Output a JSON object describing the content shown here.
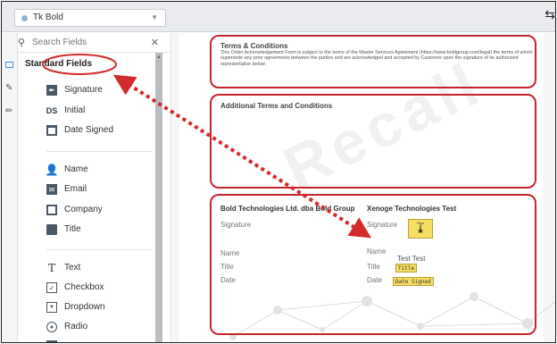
{
  "topbar": {
    "recipient": "Tk Bold",
    "recipient_color": "#8fb7d9"
  },
  "search": {
    "placeholder": "Search Fields"
  },
  "panel": {
    "section_title": "Standard Fields",
    "fields": [
      {
        "label": "Signature",
        "icon": "pen-icon"
      },
      {
        "label": "Initial",
        "icon": "ds-initial-icon",
        "icon_text": "DS"
      },
      {
        "label": "Date Signed",
        "icon": "calendar-icon"
      },
      {
        "label": "Name",
        "icon": "person-icon"
      },
      {
        "label": "Email",
        "icon": "envelope-icon"
      },
      {
        "label": "Company",
        "icon": "building-icon"
      },
      {
        "label": "Title",
        "icon": "briefcase-icon"
      },
      {
        "label": "Text",
        "icon": "text-t-icon",
        "icon_text": "T"
      },
      {
        "label": "Checkbox",
        "icon": "checkbox-icon"
      },
      {
        "label": "Dropdown",
        "icon": "dropdown-icon"
      },
      {
        "label": "Radio",
        "icon": "radio-icon"
      }
    ]
  },
  "document": {
    "terms_title": "Terms & Conditions",
    "terms_body": "This Order Acknowledgement Form is subject to the terms of the Master Services Agreement (https://www.boldgroup.com/legal) the terms of which supersede any prior agreements between the parties and are acknowledged and accepted by Customer upon the signature of its authorized representative below.",
    "additional_title": "Additional Terms and Conditions",
    "party1": "Bold Technologies Ltd. dba Bold Group",
    "party2": "Xenoge Technologies Test",
    "signature_label": "Signature",
    "name_label": "Name",
    "title_label": "Title",
    "date_label": "Date",
    "sign_button_text": "Sign",
    "name_value": "Test Test",
    "title_tag": "Title",
    "date_tag": "Date Signed",
    "watermark": "Recall"
  },
  "colors": {
    "annotation": "#c5252b",
    "tag": "#f6dd63"
  }
}
